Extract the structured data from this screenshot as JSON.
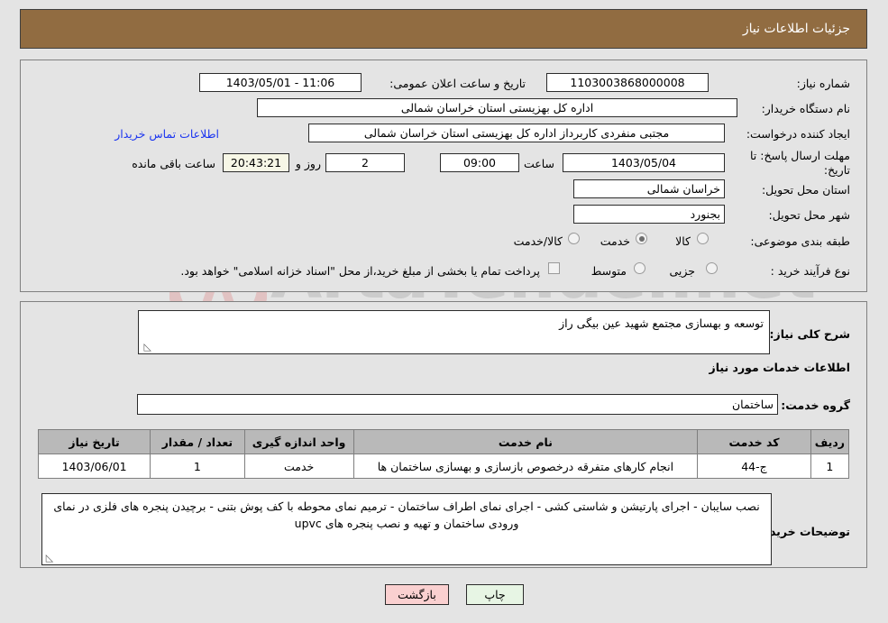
{
  "header": {
    "title": "جزئیات اطلاعات نیاز"
  },
  "watermark": {
    "text": "ArtaTender.net"
  },
  "top_panel": {
    "need_number_label": "شماره نیاز:",
    "need_number_value": "1103003868000008",
    "announce_label": "تاریخ و ساعت اعلان عمومی:",
    "announce_value": "11:06 - 1403/05/01",
    "buyer_org_label": "نام دستگاه خریدار:",
    "buyer_org_value": "اداره کل بهزیستی استان خراسان شمالی",
    "creator_label": "ایجاد کننده درخواست:",
    "creator_value": "مجتبی منفردی کاربرداز اداره کل بهزیستی استان خراسان شمالی",
    "contact_link": "اطلاعات تماس خریدار",
    "deadline_label": "مهلت ارسال پاسخ: تا تاریخ:",
    "deadline_date": "1403/05/04",
    "hour_label": "ساعت",
    "deadline_time": "09:00",
    "days_value": "2",
    "days_label": "روز و",
    "countdown_value": "20:43:21",
    "countdown_label": "ساعت باقی مانده",
    "province_label": "استان محل تحویل:",
    "province_value": "خراسان شمالی",
    "city_label": "شهر محل تحویل:",
    "city_value": "بجنورد",
    "category_label": "طبقه بندی موضوعی:",
    "category_options": [
      {
        "label": "کالا",
        "selected": false
      },
      {
        "label": "خدمت",
        "selected": true
      },
      {
        "label": "کالا/خدمت",
        "selected": false
      }
    ],
    "process_label": "نوع فرآیند خرید :",
    "process_options": [
      {
        "label": "جزیی",
        "selected": false
      },
      {
        "label": "متوسط",
        "selected": false
      }
    ],
    "treasury_note": "پرداخت تمام یا بخشی از مبلغ خرید،از محل \"اسناد خزانه اسلامی\" خواهد بود."
  },
  "bottom_panel": {
    "general_desc_label": "شرح کلی نیاز:",
    "general_desc_value": "توسعه و بهسازی مجتمع شهید عین بیگی راز",
    "services_heading": "اطلاعات خدمات مورد نیاز",
    "service_group_label": "گروه خدمت:",
    "service_group_value": "ساختمان",
    "table": {
      "columns": [
        "ردیف",
        "کد خدمت",
        "نام خدمت",
        "واحد اندازه گیری",
        "تعداد / مقدار",
        "تاریخ نیاز"
      ],
      "rows": [
        {
          "row": "1",
          "code": "ج-44",
          "name": "انجام کارهای متفرقه درخصوص بازسازی و بهسازی ساختمان ها",
          "unit": "خدمت",
          "qty": "1",
          "date": "1403/06/01"
        }
      ]
    },
    "buyer_notes_label": "توضیحات خریدار:",
    "buyer_notes_value": "نصب سایبان - اجرای پارتیشن و شاستی کشی - اجرای نمای اطراف ساختمان - ترمیم نمای محوطه با کف پوش بتنی - برچیدن پنجره های فلزی در نمای ورودی ساختمان و تهیه و نصب پنجره های upvc"
  },
  "footer": {
    "print_label": "چاپ",
    "back_label": "بازگشت"
  }
}
